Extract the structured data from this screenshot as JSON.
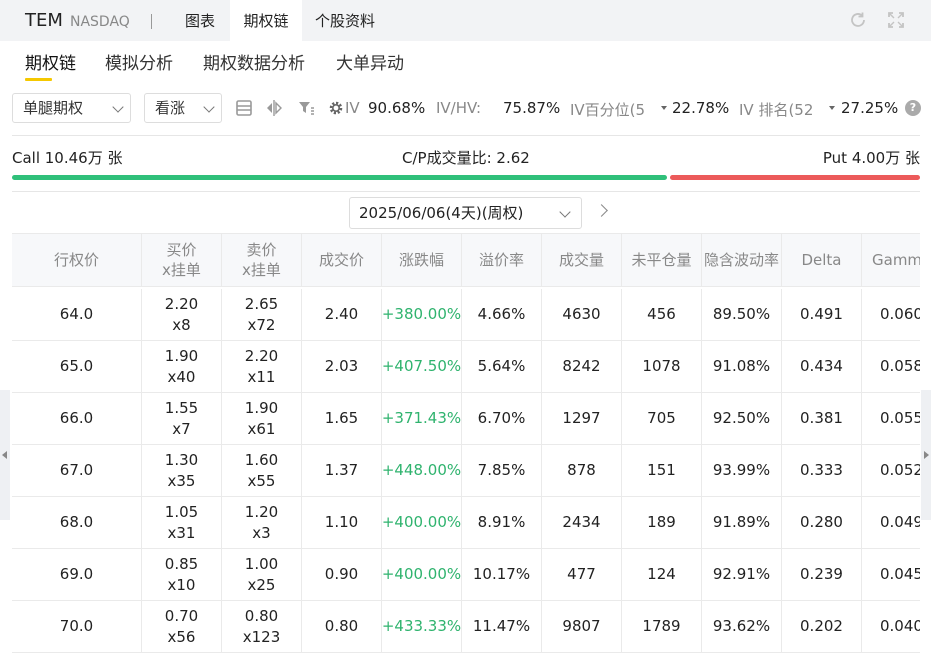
{
  "header": {
    "ticker": "TEM",
    "exchange": "NASDAQ",
    "tabs": [
      "图表",
      "期权链",
      "个股资料"
    ],
    "active_tab": "期权链"
  },
  "subtabs": [
    "期权链",
    "模拟分析",
    "期权数据分析",
    "大单异动"
  ],
  "controls": {
    "strategy_select": "单腿期权",
    "direction_select": "看涨",
    "iv_label": "IV",
    "iv_value": "90.68%",
    "ivhv_label": "IV/HV:",
    "ivhv_value": "75.87%",
    "iv_percentile_label": "IV百分位(5",
    "iv_percentile_value": "22.78%",
    "iv_rank_label": "IV 排名(52",
    "iv_rank_value": "27.25%",
    "help": "?"
  },
  "ratio": {
    "call_text": "Call 10.46万 张",
    "cp_text": "C/P成交量比:  2.62",
    "put_text": "Put 4.00万 张",
    "call_fraction": 0.7235
  },
  "expiry": {
    "value": "2025/06/06(4天)(周权)"
  },
  "table": {
    "columns": [
      "行权价",
      "买价\nx挂单",
      "卖价\nx挂单",
      "成交价",
      "涨跌幅",
      "溢价率",
      "成交量",
      "未平仓量",
      "隐含波动率",
      "Delta",
      "Gamm"
    ],
    "rows": [
      [
        "64.0",
        "2.20\nx8",
        "2.65\nx72",
        "2.40",
        "+380.00%",
        "4.66%",
        "4630",
        "456",
        "89.50%",
        "0.491",
        "0.060"
      ],
      [
        "65.0",
        "1.90\nx40",
        "2.20\nx11",
        "2.03",
        "+407.50%",
        "5.64%",
        "8242",
        "1078",
        "91.08%",
        "0.434",
        "0.058"
      ],
      [
        "66.0",
        "1.55\nx7",
        "1.90\nx61",
        "1.65",
        "+371.43%",
        "6.70%",
        "1297",
        "705",
        "92.50%",
        "0.381",
        "0.055"
      ],
      [
        "67.0",
        "1.30\nx35",
        "1.60\nx55",
        "1.37",
        "+448.00%",
        "7.85%",
        "878",
        "151",
        "93.99%",
        "0.333",
        "0.052"
      ],
      [
        "68.0",
        "1.05\nx31",
        "1.20\nx3",
        "1.10",
        "+400.00%",
        "8.91%",
        "2434",
        "189",
        "91.89%",
        "0.280",
        "0.049"
      ],
      [
        "69.0",
        "0.85\nx10",
        "1.00\nx25",
        "0.90",
        "+400.00%",
        "10.17%",
        "477",
        "124",
        "92.91%",
        "0.239",
        "0.045"
      ],
      [
        "70.0",
        "0.70\nx56",
        "0.80\nx123",
        "0.80",
        "+433.33%",
        "11.47%",
        "9807",
        "1789",
        "93.62%",
        "0.202",
        "0.040"
      ]
    ]
  },
  "colors": {
    "call_bar": "#2fc07a",
    "put_bar": "#ec5a5a",
    "positive_change": "#2fb36e",
    "accent_underline": "#f5c800"
  },
  "icons": [
    "refresh-icon",
    "expand-icon",
    "list-icon",
    "compare-icon",
    "filter-icon",
    "gear-icon",
    "help-icon",
    "chevron-right-icon"
  ]
}
